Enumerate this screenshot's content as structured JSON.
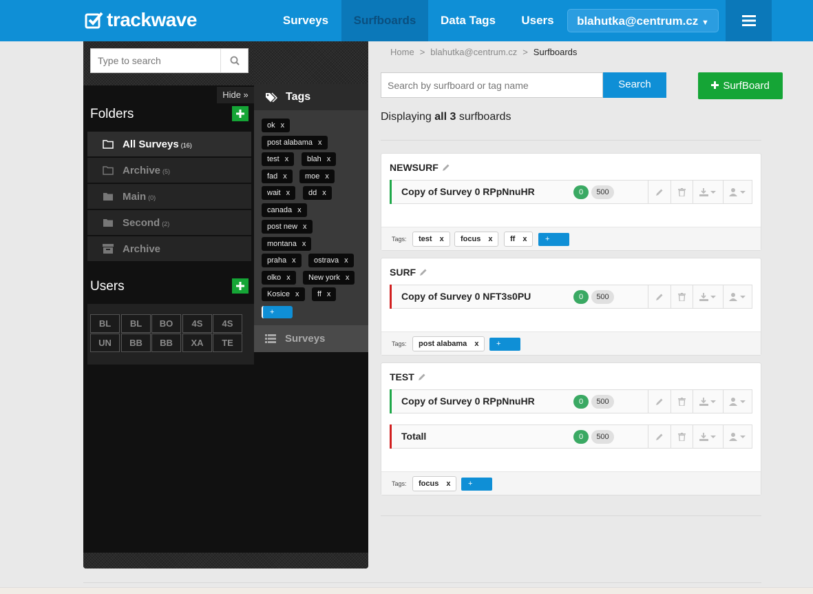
{
  "brand": {
    "name": "trackwave"
  },
  "nav": {
    "items": [
      {
        "label": "Surveys"
      },
      {
        "label": "Surfboards",
        "active": true
      },
      {
        "label": "Data Tags"
      },
      {
        "label": "Users"
      }
    ],
    "user": "blahutka@centrum.cz",
    "menu_icon": "hamburger-icon"
  },
  "sidebar": {
    "search_placeholder": "Type to search",
    "hide_label": "Hide »",
    "folders_title": "Folders",
    "folders": [
      {
        "label": "All Surveys",
        "count": "(16)",
        "icon": "folder-open-icon",
        "active": true
      },
      {
        "label": "Archive",
        "count": "(5)",
        "icon": "folder-open-icon"
      },
      {
        "label": "Main",
        "count": "(0)",
        "icon": "folder-icon"
      },
      {
        "label": "Second",
        "count": "(2)",
        "icon": "folder-icon"
      },
      {
        "label": "Archive",
        "count": "",
        "icon": "archive-box-icon"
      }
    ],
    "users_title": "Users",
    "users": [
      "BL",
      "BL",
      "BO",
      "4S",
      "4S",
      "UN",
      "BB",
      "BB",
      "XA",
      "TE"
    ],
    "tags_title": "Tags",
    "tags": [
      "ok",
      "post alabama",
      "test",
      "blah",
      "fad",
      "moe",
      "wait",
      "dd",
      "canada",
      "post new",
      "montana",
      "praha",
      "ostrava",
      "olko",
      "New york",
      "Kosice",
      "ff"
    ],
    "tag_remove": "x",
    "tag_add": "+",
    "surveys_tab": "Surveys"
  },
  "breadcrumb": [
    "Home",
    "blahutka@centrum.cz",
    "Surfboards"
  ],
  "breadcrumb_sep": ">",
  "search": {
    "placeholder": "Search by surfboard or tag name",
    "button": "Search"
  },
  "add_button": "SurfBoard",
  "display": {
    "prefix": "Displaying",
    "bold": "all 3",
    "suffix": "surfboards"
  },
  "colors": {
    "accent": "#0f8fd6",
    "green": "#15a536",
    "status_green": "#1fa84a",
    "status_red": "#d12020"
  },
  "tags_label": "Tags:",
  "surfboards": [
    {
      "name": "NEWSURF",
      "surveys": [
        {
          "name": "Copy of Survey 0 RPpNnuHR",
          "count": "0",
          "limit": "500",
          "status": "green"
        }
      ],
      "tags": [
        "test",
        "focus",
        "ff"
      ]
    },
    {
      "name": "SURF",
      "surveys": [
        {
          "name": "Copy of Survey 0 NFT3s0PU",
          "count": "0",
          "limit": "500",
          "status": "red"
        }
      ],
      "tags": [
        "post alabama"
      ]
    },
    {
      "name": "TEST",
      "surveys": [
        {
          "name": "Copy of Survey 0 RPpNnuHR",
          "count": "0",
          "limit": "500",
          "status": "green"
        },
        {
          "name": "Totall",
          "count": "0",
          "limit": "500",
          "status": "red"
        }
      ],
      "tags": [
        "focus"
      ]
    }
  ]
}
